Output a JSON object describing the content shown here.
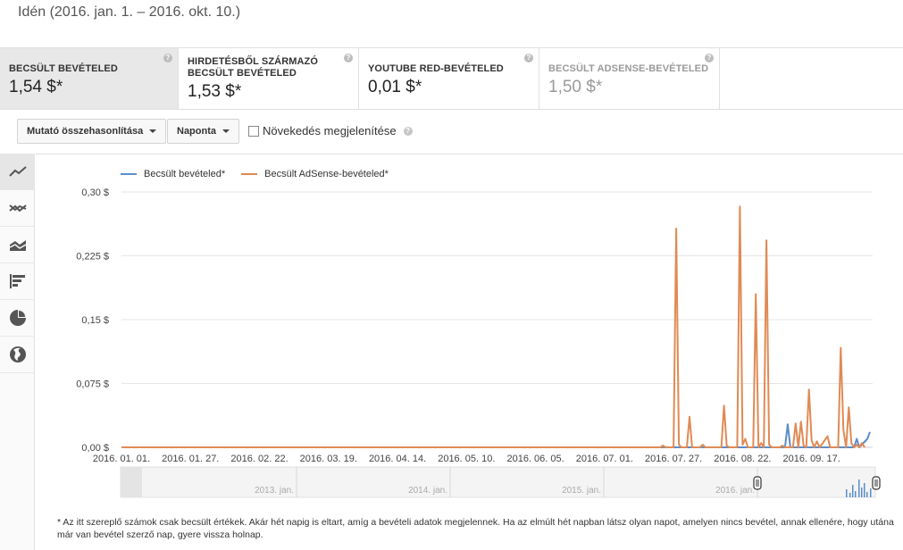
{
  "date_range": "Idén (2016. jan. 1. – 2016. okt. 10.)",
  "metrics": [
    {
      "label": "BECSÜLT BEVÉTELED",
      "value": "1,54 $*",
      "help": "?"
    },
    {
      "label": "HIRDETÉSBŐL SZÁRMAZÓ BECSÜLT BEVÉTELED",
      "value": "1,53 $*",
      "help": "?"
    },
    {
      "label": "YOUTUBE RED-BEVÉTELED",
      "value": "0,01 $*",
      "help": "?"
    },
    {
      "label": "BECSÜLT ADSENSE-BEVÉTELED",
      "value": "1,50 $*",
      "help": "?"
    }
  ],
  "controls": {
    "compare_label": "Mutató összehasonlítása",
    "granularity_label": "Naponta",
    "growth_label": "Növekedés megjelenítése",
    "growth_help": "?"
  },
  "sidebar_icons": [
    "line-chart-icon",
    "multi-line-chart-icon",
    "stacked-area-icon",
    "bar-chart-icon",
    "pie-chart-icon",
    "globe-icon"
  ],
  "colors": {
    "series_blue": "#5b8ec8",
    "series_orange": "#e08a55",
    "grid": "#e6e6e6"
  },
  "chart_data": {
    "type": "line",
    "ylim": [
      0,
      0.3
    ],
    "yticks": [
      "0,00 $",
      "0,075 $",
      "0,15 $",
      "0,225 $",
      "0,30 $"
    ],
    "ytick_values": [
      0,
      0.075,
      0.15,
      0.225,
      0.3
    ],
    "x_domain": [
      0,
      283
    ],
    "xticks": [
      "2016. 01. 01.",
      "2016. 01. 27.",
      "2016. 02. 22.",
      "2016. 03. 19.",
      "2016. 04. 14.",
      "2016. 05. 10.",
      "2016. 06. 05.",
      "2016. 07. 01.",
      "2016. 07. 27.",
      "2016. 08. 22.",
      "2016. 09. 17."
    ],
    "xtick_days": [
      0,
      26,
      52,
      78,
      104,
      130,
      156,
      182,
      208,
      234,
      260
    ],
    "series": [
      {
        "name": "Becsült bevételed*",
        "color": "#5b8ec8",
        "points": [
          [
            0,
            0
          ],
          [
            250,
            0
          ],
          [
            251,
            0.027
          ],
          [
            252,
            0
          ],
          [
            276,
            0
          ],
          [
            277,
            0.01
          ],
          [
            278,
            0
          ],
          [
            281,
            0.01
          ],
          [
            282,
            0.018
          ]
        ]
      },
      {
        "name": "Becsült AdSense-bevételed*",
        "color": "#e08a55",
        "points": [
          [
            0,
            0
          ],
          [
            203,
            0
          ],
          [
            204,
            0.002
          ],
          [
            205,
            0
          ],
          [
            208,
            0
          ],
          [
            209,
            0.257
          ],
          [
            210,
            0.003
          ],
          [
            211,
            0
          ],
          [
            213,
            0
          ],
          [
            214,
            0.036
          ],
          [
            215,
            0
          ],
          [
            218,
            0
          ],
          [
            219,
            0.003
          ],
          [
            220,
            0
          ],
          [
            226,
            0
          ],
          [
            227,
            0.049
          ],
          [
            228,
            0.002
          ],
          [
            229,
            0
          ],
          [
            232,
            0
          ],
          [
            233,
            0.283
          ],
          [
            234,
            0.003
          ],
          [
            235,
            0.01
          ],
          [
            236,
            0
          ],
          [
            238,
            0
          ],
          [
            239,
            0.18
          ],
          [
            240,
            0
          ],
          [
            241,
            0.005
          ],
          [
            242,
            0
          ],
          [
            243,
            0.243
          ],
          [
            244,
            0.003
          ],
          [
            245,
            0
          ],
          [
            248,
            0
          ],
          [
            249,
            0.002
          ],
          [
            250,
            0
          ],
          [
            253,
            0
          ],
          [
            254,
            0.028
          ],
          [
            255,
            0
          ],
          [
            256,
            0.03
          ],
          [
            257,
            0.002
          ],
          [
            258,
            0
          ],
          [
            259,
            0.068
          ],
          [
            260,
            0.008
          ],
          [
            261,
            0
          ],
          [
            262,
            0.007
          ],
          [
            263,
            0
          ],
          [
            264,
            0.004
          ],
          [
            265
          ],
          [
            266,
            0.013
          ],
          [
            267,
            0
          ],
          [
            270,
            0
          ],
          [
            271,
            0.117
          ],
          [
            272,
            0.02
          ],
          [
            273,
            0
          ],
          [
            274,
            0.047
          ],
          [
            275,
            0.005
          ],
          [
            276,
            0
          ],
          [
            277,
            0.003
          ],
          [
            278,
            0
          ],
          [
            279,
            0.005
          ],
          [
            280,
            0
          ]
        ]
      }
    ]
  },
  "timeline": {
    "labels": [
      "2013. jan.",
      "2014. jan.",
      "2015. jan.",
      "2016. jan."
    ]
  },
  "footnote": "* Az itt szereplő számok csak becsült értékek. Akár hét napig is eltart, amíg a bevételi adatok megjelennek. Ha az elmúlt hét napban látsz olyan napot, amelyen nincs bevétel, annak ellenére, hogy utána már van bevétel szerző nap, gyere vissza holnap."
}
